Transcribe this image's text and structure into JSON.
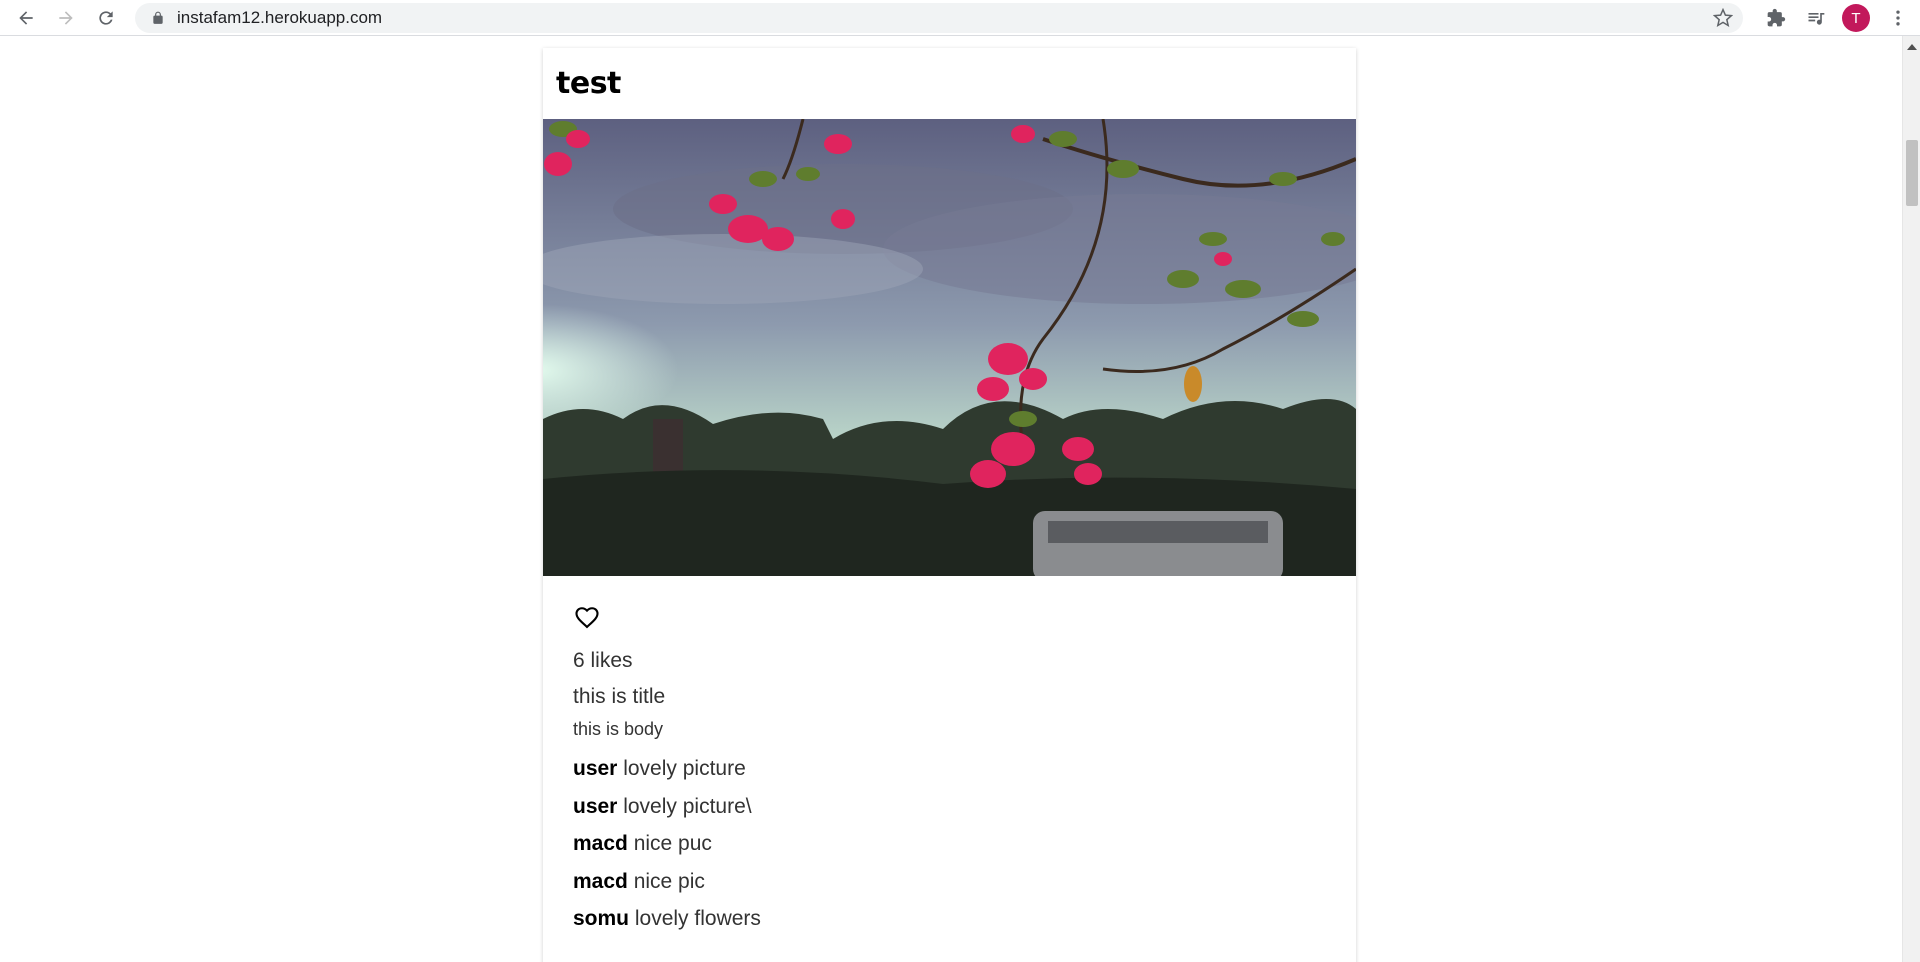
{
  "browser": {
    "url": "instafam12.herokuapp.com",
    "profile_initial": "T",
    "profile_color": "#c2185b"
  },
  "post": {
    "author": "test",
    "image_description_icon": "photo-image",
    "likes_text": "6 likes",
    "title": "this is title",
    "body": "this is body",
    "comments": [
      {
        "user": "user",
        "text": "lovely picture"
      },
      {
        "user": "user",
        "text": "lovely picture\\"
      },
      {
        "user": "macd",
        "text": "nice puc"
      },
      {
        "user": "macd",
        "text": "nice pic"
      },
      {
        "user": "somu",
        "text": "lovely flowers"
      }
    ]
  },
  "icons": {
    "back": "arrow-back-icon",
    "forward": "arrow-forward-icon",
    "reload": "reload-icon",
    "lock": "lock-icon",
    "bookmark": "star-icon",
    "extensions": "puzzle-icon",
    "media": "playlist-icon",
    "menu": "kebab-menu-icon",
    "like": "heart-icon"
  },
  "colors": {
    "chrome_bg": "#ffffff",
    "omnibox_bg": "#f1f3f4",
    "text": "#333333"
  }
}
